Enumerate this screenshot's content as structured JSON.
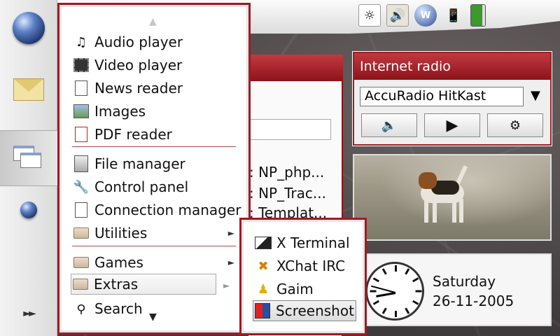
{
  "status_bar": {
    "icons": [
      "display-settings-icon",
      "volume-icon",
      "internet-connection-icon",
      "phone-icon",
      "battery-icon"
    ]
  },
  "task_navigator": {
    "items": [
      "web-browser-icon",
      "email-icon",
      "application-switcher-icon",
      "internet-globe-icon",
      "expand-arrows-icon"
    ],
    "expand_glyph": "►►"
  },
  "background_app": {
    "lines": [
      ": NP_php...",
      ": NP_Trac...",
      ": Templat..."
    ]
  },
  "main_menu": {
    "scroll_up": "▲",
    "scroll_down": "▼",
    "items": [
      {
        "label": "Audio player",
        "icon": "music-note-icon"
      },
      {
        "label": "Video player",
        "icon": "film-icon"
      },
      {
        "label": "News reader",
        "icon": "news-icon"
      },
      {
        "label": "Images",
        "icon": "image-icon"
      },
      {
        "label": "PDF reader",
        "icon": "pdf-icon"
      },
      {
        "label": "File manager",
        "icon": "file-cabinet-icon"
      },
      {
        "label": "Control panel",
        "icon": "wrench-icon"
      },
      {
        "label": "Connection manager",
        "icon": "connection-icon"
      },
      {
        "label": "Utilities",
        "icon": "folder-icon"
      },
      {
        "label": "Games",
        "icon": "folder-icon"
      },
      {
        "label": "Extras",
        "icon": "folder-icon"
      },
      {
        "label": "Search",
        "icon": "binoculars-icon"
      }
    ],
    "submenu_arrow": "►"
  },
  "extras_submenu": {
    "items": [
      {
        "label": "X Terminal",
        "icon": "terminal-icon"
      },
      {
        "label": "XChat IRC",
        "icon": "xchat-icon"
      },
      {
        "label": "Gaim",
        "icon": "gaim-icon"
      },
      {
        "label": "Screenshot",
        "icon": "screenshot-icon"
      }
    ]
  },
  "internet_radio": {
    "title": "Internet radio",
    "station": "AccuRadio HitKast",
    "dropdown_glyph": "▼",
    "buttons": [
      "volume-icon",
      "play-icon",
      "settings-icon"
    ]
  },
  "clock_applet": {
    "day": "Saturday",
    "date": "26-11-2005"
  }
}
